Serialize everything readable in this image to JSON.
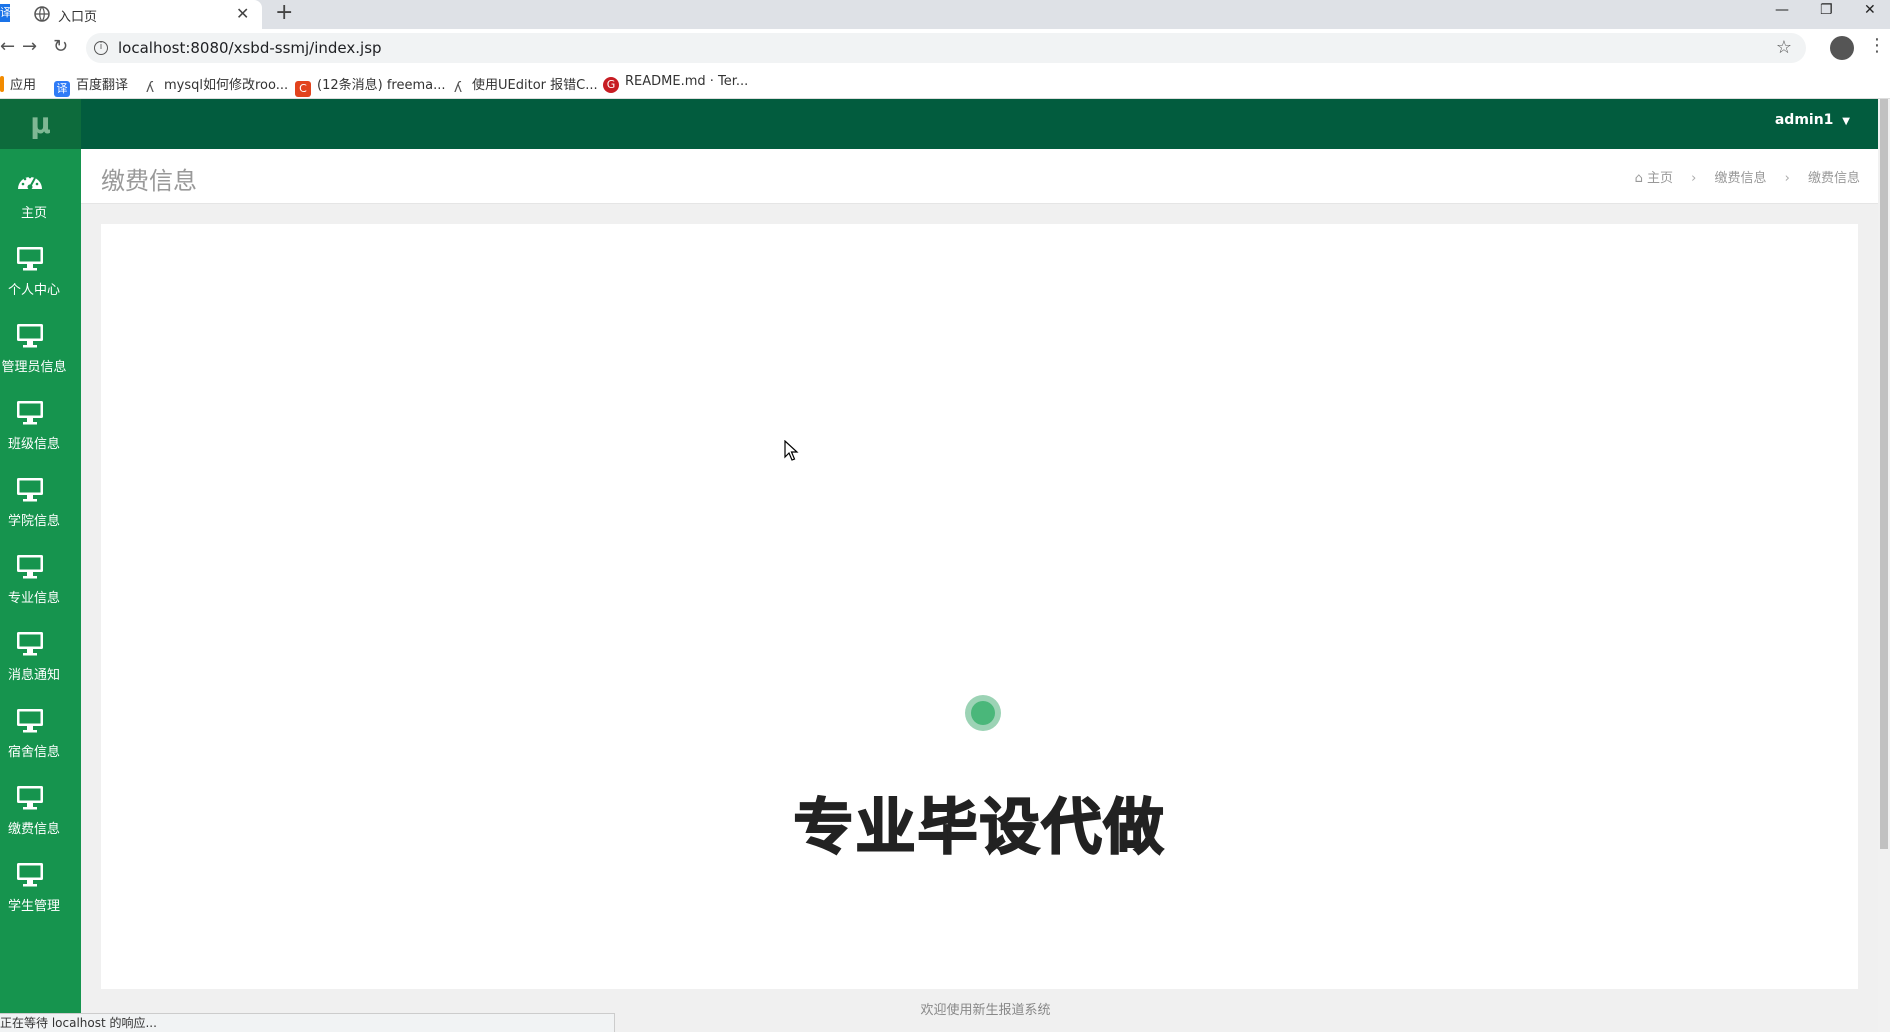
{
  "browser": {
    "tab_title": "入口页",
    "left_mark": "译",
    "url": "localhost:8080/xsbd-ssmj/index.jsp",
    "bookmarks": [
      {
        "label": "应用",
        "icon": "apps-icon",
        "color": "#f28b00"
      },
      {
        "label": "百度翻译",
        "icon": "baidu-translate-icon",
        "color": "#2f7bf6"
      },
      {
        "label": "mysql如何修改roo...",
        "icon": "mysql-favicon-icon",
        "color": "#555555"
      },
      {
        "label": "(12条消息) freema...",
        "icon": "csdn-icon",
        "color": "#e2431d"
      },
      {
        "label": "使用UEditor 报错C...",
        "icon": "ueditor-favicon-icon",
        "color": "#555555"
      },
      {
        "label": "README.md · Ter...",
        "icon": "gitee-icon",
        "color": "#c71d23"
      }
    ],
    "status_text": "正在等待 localhost 的响应..."
  },
  "app": {
    "logo": "μ",
    "user": "admin1",
    "nav": [
      {
        "label": "主页",
        "icon": "dashboard-icon"
      },
      {
        "label": "个人中心",
        "icon": "monitor-icon"
      },
      {
        "label": "管理员信息",
        "icon": "monitor-icon"
      },
      {
        "label": "班级信息",
        "icon": "monitor-icon"
      },
      {
        "label": "学院信息",
        "icon": "monitor-icon"
      },
      {
        "label": "专业信息",
        "icon": "monitor-icon"
      },
      {
        "label": "消息通知",
        "icon": "monitor-icon"
      },
      {
        "label": "宿舍信息",
        "icon": "monitor-icon"
      },
      {
        "label": "缴费信息",
        "icon": "monitor-icon"
      },
      {
        "label": "学生管理",
        "icon": "monitor-icon"
      }
    ],
    "page_title": "缴费信息",
    "breadcrumb": [
      "主页",
      "缴费信息",
      "缴费信息"
    ],
    "watermark": "专业毕设代做",
    "footer": "欢迎使用新生报道系统"
  },
  "colors": {
    "sidebar": "#16944e",
    "topbar": "#025c3e",
    "spinner": "#4ab77a"
  }
}
